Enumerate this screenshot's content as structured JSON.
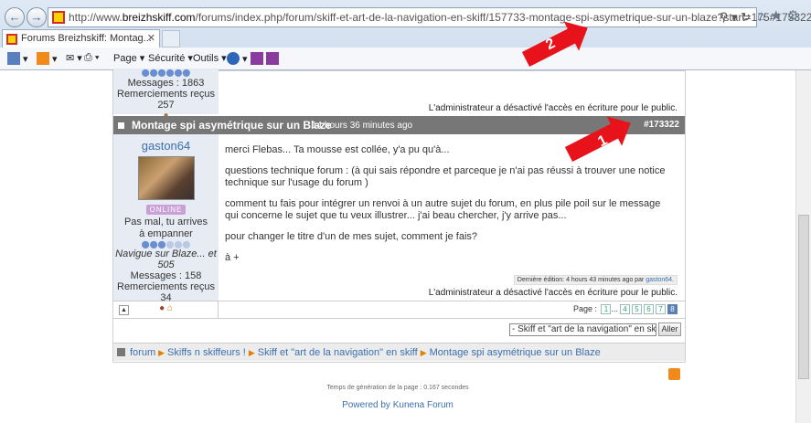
{
  "browser": {
    "url_prefix": "http://www.",
    "url_domain": "breizhskiff.com",
    "url_rest": "/forums/index.php/forum/skiff-et-art-de-la-navigation-en-skiff/157733-montage-spi-asymetrique-sur-un-blaze?start=175#173322",
    "tab_title": "Forums Breizhskiff: Montag...",
    "menu": {
      "page": "Page",
      "securite": "Sécurité",
      "outils": "Outils"
    }
  },
  "prev_post": {
    "messages": "Messages : 1863",
    "thanks": "Remerciements reçus 257",
    "admin_note": "L'administrateur a désactivé l'accès en écriture pour le public."
  },
  "topic": {
    "title": "Montage spi asymétrique sur un Blaze",
    "time": "14 hours 36 minutes ago",
    "id": "#173322"
  },
  "author": {
    "name": "gaston64",
    "status": "ONLINE",
    "tagline": "Pas mal, tu arrives à empanner",
    "motto": "Navigue sur Blaze... et 505",
    "messages": "Messages : 158",
    "thanks": "Remerciements reçus 34"
  },
  "post": {
    "p1": "merci Flebas... Ta mousse est collée, y'a pu qu'à...",
    "p2": "questions technique forum : (à qui sais répondre et parceque je n'ai pas réussi à trouver une notice technique sur l'usage du forum )",
    "p3": "comment tu fais pour intégrer un renvoi à un autre sujet du forum, en plus pile poil sur le message qui concerne le sujet que tu veux illustrer... j'ai beau chercher, j'y arrive pas...",
    "p4": "pour changer le titre d'un de mes sujet, comment je fais?",
    "p5": "à +",
    "edit_note": "Dernière édition: 4 hours 43 minutes ago par",
    "edit_user": "gaston64.",
    "admin_note": "L'administrateur a désactivé l'accès en écriture pour le public."
  },
  "pagination": {
    "label": "Page :",
    "p1": "1",
    "ellipsis": "...",
    "p4": "4",
    "p5": "5",
    "p6": "6",
    "p7": "7",
    "p8": "8"
  },
  "jump": {
    "selected": "- Skiff et \"art de la navigation\" en skiff",
    "button": "Aller"
  },
  "breadcrumbs": [
    "forum",
    "Skiffs n skiffeurs !",
    "Skiff et \"art de la navigation\" en skiff",
    "Montage spi asymétrique sur un Blaze"
  ],
  "footer": {
    "generation": "Temps de génération de la page : 0.167 secondes",
    "powered": "Powered by Kunena Forum"
  },
  "annotations": {
    "arrow1": "1",
    "arrow2": "2"
  },
  "colors": {
    "topic_bar": "#777777",
    "link": "#3a6fb0",
    "arrow": "#e8121a",
    "user_panel": "#e7ebf3"
  }
}
